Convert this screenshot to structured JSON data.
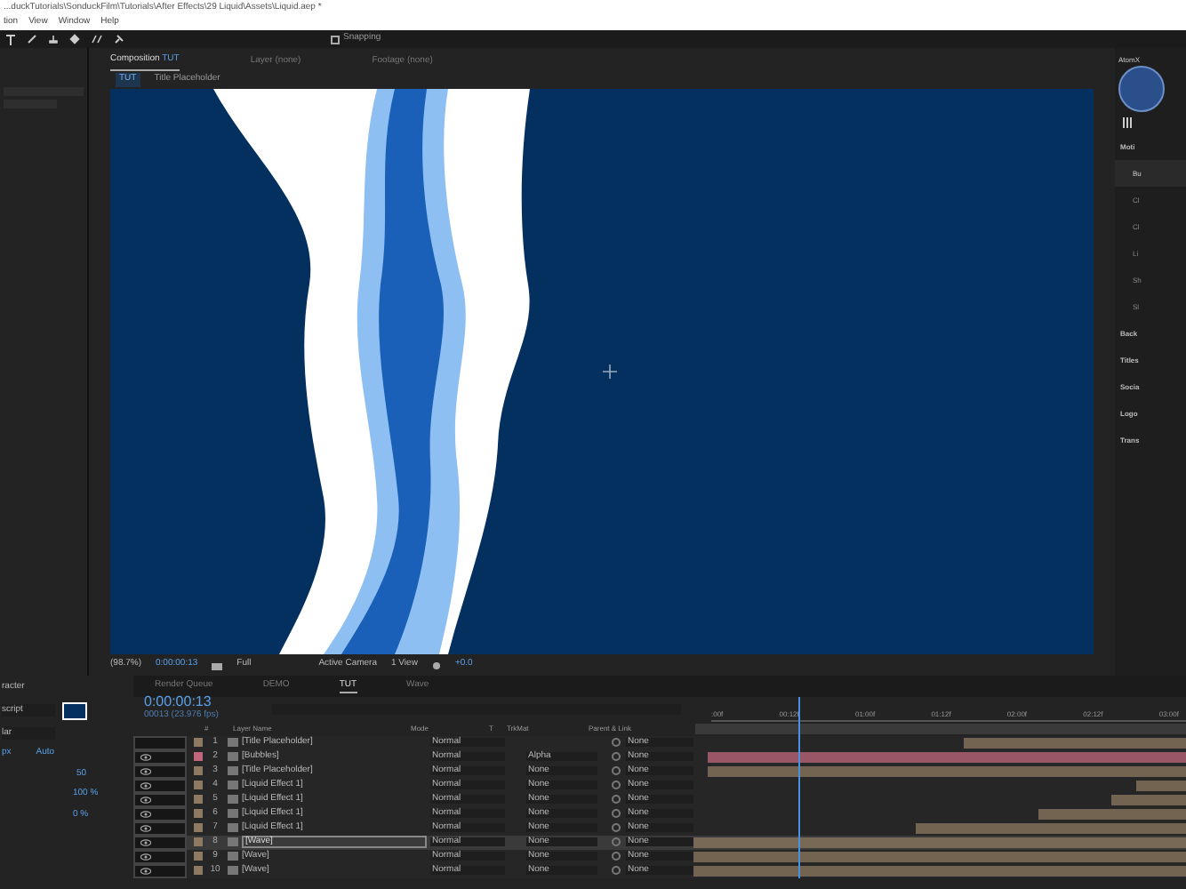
{
  "title_bar": {
    "path": "...duckTutorials\\SonduckFilm\\Tutorials\\After Effects\\29 Liquid\\Assets\\Liquid.aep *"
  },
  "menu": [
    "tion",
    "View",
    "Window",
    "Help"
  ],
  "toolbar": {
    "snapping": {
      "label": "Snapping",
      "checked": false
    }
  },
  "composition_panel": {
    "tabs": [
      {
        "label": "Composition",
        "comp": "TUT",
        "selected": true
      },
      {
        "label": "Layer",
        "comp": "(none)",
        "selected": false
      },
      {
        "label": "Footage",
        "comp": "(none)",
        "selected": false
      }
    ],
    "breadcrumbs": [
      {
        "label": "TUT",
        "selected": true
      },
      {
        "label": "Title Placeholder",
        "selected": false
      }
    ],
    "viewer_bar": {
      "zoom": "(98.7%)",
      "timecode": "0:00:00:13",
      "resolution": "Full",
      "camera": "Active Camera",
      "views": "1 View",
      "exposure": "+0.0"
    }
  },
  "right_panel": {
    "title": "AtomX",
    "items": [
      {
        "label": "Moti",
        "children": [
          {
            "label": "Bu",
            "selected": true
          },
          {
            "label": "Cl",
            "selected": false
          },
          {
            "label": "Cl",
            "selected": false
          },
          {
            "label": "Li",
            "selected": false
          },
          {
            "label": "Sh",
            "selected": false
          },
          {
            "label": "Sl",
            "selected": false
          }
        ]
      },
      {
        "label": "Back"
      },
      {
        "label": "Titles"
      },
      {
        "label": "Socia"
      },
      {
        "label": "Logo"
      },
      {
        "label": "Trans"
      }
    ]
  },
  "character_panel": {
    "title": "racter",
    "font": "script",
    "style": "lar",
    "size": "px",
    "leading": "Auto",
    "kerning": "50",
    "vscale": "100 %",
    "baseline": "0 %"
  },
  "timeline": {
    "tabs": [
      {
        "label": "Render Queue",
        "selected": false
      },
      {
        "label": "DEMO",
        "selected": false
      },
      {
        "label": "TUT",
        "selected": true
      },
      {
        "label": "Wave",
        "selected": false
      }
    ],
    "timecode": "0:00:00:13",
    "frames": "00013 (23.976 fps)",
    "columns": [
      "#",
      "Layer Name",
      "Mode",
      "T",
      "TrkMat",
      "Parent & Link"
    ],
    "ruler": [
      ":00f",
      "00:12f",
      "01:00f",
      "01:12f",
      "02:00f",
      "02:12f",
      "03:00f"
    ],
    "rows": [
      {
        "num": "1",
        "name": "[Title Placeholder]",
        "mode": "Normal",
        "trkmat": "",
        "parent": "None",
        "color": "#8e7a62",
        "selected": false,
        "visible": false
      },
      {
        "num": "2",
        "name": "[Bubbles]",
        "mode": "Normal",
        "trkmat": "Alpha",
        "parent": "None",
        "color": "#c0677d",
        "selected": false,
        "visible": true
      },
      {
        "num": "3",
        "name": "[Title Placeholder]",
        "mode": "Normal",
        "trkmat": "None",
        "parent": "None",
        "color": "#8e7a62",
        "selected": false,
        "visible": true
      },
      {
        "num": "4",
        "name": "[Liquid Effect 1]",
        "mode": "Normal",
        "trkmat": "None",
        "parent": "None",
        "color": "#8e7a62",
        "selected": false,
        "visible": true
      },
      {
        "num": "5",
        "name": "[Liquid Effect 1]",
        "mode": "Normal",
        "trkmat": "None",
        "parent": "None",
        "color": "#8e7a62",
        "selected": false,
        "visible": true
      },
      {
        "num": "6",
        "name": "[Liquid Effect 1]",
        "mode": "Normal",
        "trkmat": "None",
        "parent": "None",
        "color": "#8e7a62",
        "selected": false,
        "visible": true
      },
      {
        "num": "7",
        "name": "[Liquid Effect 1]",
        "mode": "Normal",
        "trkmat": "None",
        "parent": "None",
        "color": "#8e7a62",
        "selected": false,
        "visible": true
      },
      {
        "num": "8",
        "name": "[Wave]",
        "mode": "Normal",
        "trkmat": "None",
        "parent": "None",
        "color": "#8e7a62",
        "selected": true,
        "visible": true
      },
      {
        "num": "9",
        "name": "[Wave]",
        "mode": "Normal",
        "trkmat": "None",
        "parent": "None",
        "color": "#8e7a62",
        "selected": false,
        "visible": true
      },
      {
        "num": "10",
        "name": "[Wave]",
        "mode": "Normal",
        "trkmat": "None",
        "parent": "None",
        "color": "#8e7a62",
        "selected": false,
        "visible": true
      }
    ]
  }
}
